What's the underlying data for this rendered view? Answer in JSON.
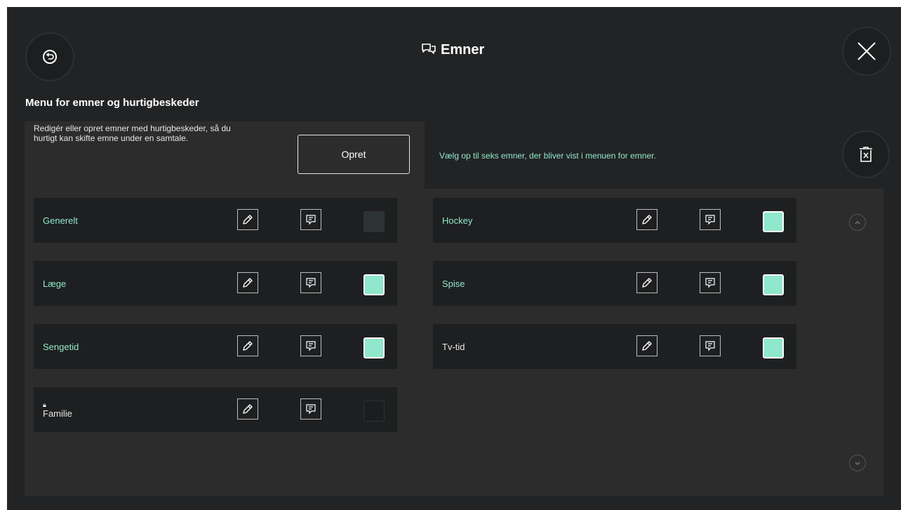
{
  "header": {
    "title": "Emner",
    "back_icon": "undo-icon",
    "title_icon": "chat-bubbles-icon",
    "close_icon": "close-icon",
    "delete_icon": "trash-icon"
  },
  "section": {
    "heading": "Menu for emner og hurtigbeskeder",
    "description": "Redigér eller opret emner med hurtigbeskeder, så du hurtigt kan skifte emne under en samtale.",
    "create_label": "Opret",
    "hint": "Vælg op til seks emner, der bliver vist i menuen for emner."
  },
  "topics_left": [
    {
      "name": "Generelt",
      "selected": false,
      "locked": false
    },
    {
      "name": "Læge",
      "selected": true,
      "locked": false
    },
    {
      "name": "Sengetid",
      "selected": true,
      "locked": false
    },
    {
      "name": "Familie",
      "selected": false,
      "locked": true
    }
  ],
  "topics_right": [
    {
      "name": "Hockey",
      "selected": true,
      "locked": false
    },
    {
      "name": "Spise",
      "selected": true,
      "locked": false
    },
    {
      "name": "Tv-tid",
      "selected": true,
      "locked": false
    }
  ],
  "colors": {
    "accent": "#8fe8cc",
    "background": "#222324",
    "panel": "#2c2c2c",
    "row": "#1e1f20"
  }
}
